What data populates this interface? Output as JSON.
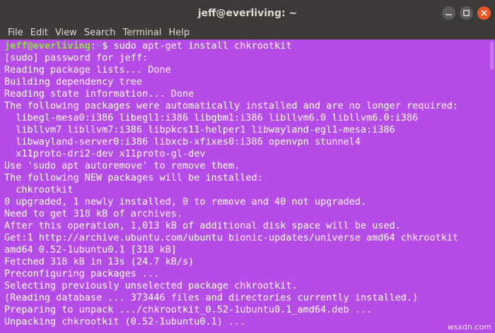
{
  "window": {
    "title": "jeff@everliving: ~",
    "buttons": [
      {
        "name": "minimize",
        "glyph": "—"
      },
      {
        "name": "maximize",
        "glyph": "□"
      },
      {
        "name": "close",
        "glyph": "✕"
      }
    ]
  },
  "menu": [
    "File",
    "Edit",
    "View",
    "Search",
    "Terminal",
    "Help"
  ],
  "prompt": {
    "user": "jeff@everliving",
    "sep": ":",
    "path": "~",
    "symbol": "$ ",
    "command": "sudo apt-get install chkrootkit"
  },
  "output": [
    "[sudo] password for jeff:",
    "Reading package lists... Done",
    "Building dependency tree",
    "Reading state information... Done",
    "The following packages were automatically installed and are no longer required:",
    "  libegl-mesa0:i386 libegl1:i386 libgbm1:i386 libllvm6.0 libllvm6.0:i386",
    "  libllvm7 libllvm7:i386 libpkcs11-helper1 libwayland-egl1-mesa:i386",
    "  libwayland-server0:i386 libxcb-xfixes0:i386 openvpn stunnel4",
    "  x11proto-dri2-dev x11proto-gl-dev",
    "Use 'sudo apt autoremove' to remove them.",
    "The following NEW packages will be installed:",
    "  chkrootkit",
    "0 upgraded, 1 newly installed, 0 to remove and 40 not upgraded.",
    "Need to get 318 kB of archives.",
    "After this operation, 1,013 kB of additional disk space will be used.",
    "Get:1 http://archive.ubuntu.com/ubuntu bionic-updates/universe amd64 chkrootkit",
    "amd64 0.52-1ubuntu0.1 [318 kB]",
    "Fetched 318 kB in 13s (24.7 kB/s)",
    "Preconfiguring packages ...",
    "Selecting previously unselected package chkrootkit.",
    "(Reading database ... 373446 files and directories currently installed.)",
    "Preparing to unpack .../chkrootkit_0.52-1ubuntu0.1_amd64.deb ...",
    "Unpacking chkrootkit (0.52-1ubuntu0.1) ..."
  ],
  "watermark": "wsxdn.com",
  "colors": {
    "terminal_bg": "#b64ce8",
    "titlebar_bg": "#3b3a37",
    "prompt_user": "#8ae234",
    "prompt_path": "#729fcf",
    "close_button": "#e8572a"
  }
}
